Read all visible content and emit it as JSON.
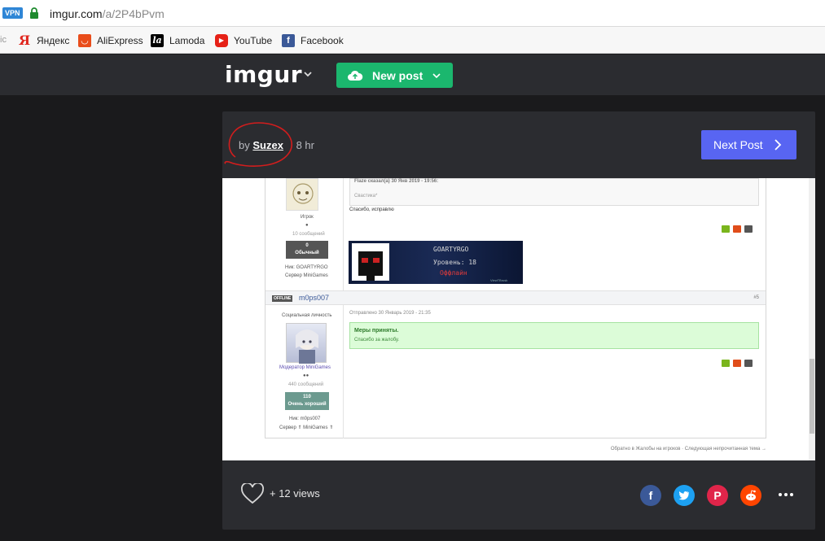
{
  "browser": {
    "vpn_label": "VPN",
    "url_host": "imgur.com",
    "url_path": "/a/2P4bPvm",
    "bookmarks": [
      {
        "label": "Яндекс",
        "icon": "yandex-icon",
        "color": "#e0261e"
      },
      {
        "label": "AliExpress",
        "icon": "aliexpress-icon",
        "color": "#e94d1b"
      },
      {
        "label": "Lamoda",
        "icon": "lamoda-icon",
        "color": "#000000"
      },
      {
        "label": "YouTube",
        "icon": "youtube-icon",
        "color": "#e62117"
      },
      {
        "label": "Facebook",
        "icon": "facebook-icon",
        "color": "#3b5998"
      }
    ]
  },
  "header": {
    "logo": "imgur",
    "new_post_label": "New post",
    "accent": "#1bb76e"
  },
  "post": {
    "by_label": "by",
    "author": "Suzex",
    "time": "8 hr",
    "next_post_label": "Next Post",
    "next_accent": "#5865f2",
    "views_label": "+ 12 views"
  },
  "forum": {
    "quote_head": "Flaze сказал(а) 30 Янв 2019 - 19:56:",
    "quote_body": "Свастика*",
    "reply_text": "Спасибо, исправлю",
    "user1_role": "Игрок",
    "user1_posts": "10 сообщений",
    "user1_rep_value": "0",
    "user1_rep_label": "Обычный",
    "user1_nick": "Ник: GOARTYRGO",
    "user1_server": "Сервер MiniGames",
    "banner_line1": "GOARTYRGO",
    "banner_line2": "Уровень: 18",
    "banner_line3": "Оффлайн",
    "banner_tag": "ViewTBrusk",
    "offline_badge": "OFFLINE",
    "user2_name": "m0ps007",
    "post_number": "#5",
    "user2_title": "Социальная личность",
    "sent_label": "Отправлено 30 Январь 2019 - 21:35",
    "success_title": "Меры приняты.",
    "success_body": "Спасибо за жалобу.",
    "user2_role": "Модератор MiniGames",
    "user2_posts": "440 сообщений",
    "user2_rep_value": "110",
    "user2_rep_label": "Очень хороший",
    "user2_nick": "Ник: m0ps007",
    "user2_server": "Сервер ⇑ MiniGames ⇑",
    "footer_links": "Обратно в Жалобы на игроков · Следующая непрочитанная тема →"
  }
}
